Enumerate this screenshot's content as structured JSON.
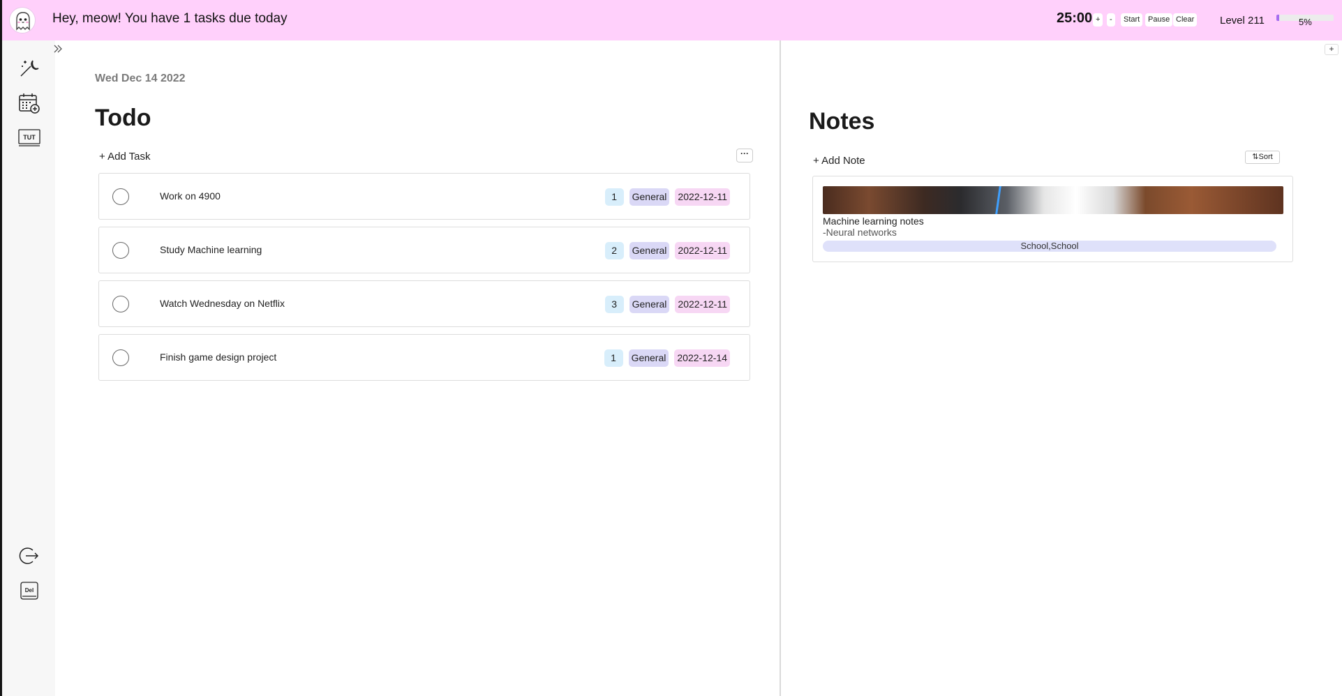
{
  "header": {
    "greeting": "Hey, meow! You have 1 tasks due today",
    "timer": "25:00",
    "timer_plus": "+",
    "timer_minus": "-",
    "start_label": "Start",
    "pause_label": "Pause",
    "clear_label": "Clear",
    "level_label": "Level 211",
    "xp_percent_label": "5%",
    "xp_progress": 0.05
  },
  "sidebar": {
    "items": [
      {
        "icon": "theme-toggle-icon"
      },
      {
        "icon": "calendar-add-icon"
      },
      {
        "icon": "tutorial-icon",
        "text": "TUT"
      },
      {
        "icon": "logout-icon"
      },
      {
        "icon": "delete-account-icon",
        "text": "Del"
      }
    ]
  },
  "todo": {
    "date": "Wed Dec 14 2022",
    "title": "Todo",
    "add_label": "+ Add Task",
    "more_label": "···",
    "tasks": [
      {
        "name": "Work on 4900",
        "priority": "1",
        "category": "General",
        "due": "2022-12-11"
      },
      {
        "name": "Study Machine learning",
        "priority": "2",
        "category": "General",
        "due": "2022-12-11"
      },
      {
        "name": "Watch Wednesday on Netflix",
        "priority": "3",
        "category": "General",
        "due": "2022-12-11"
      },
      {
        "name": "Finish game design project",
        "priority": "1",
        "category": "General",
        "due": "2022-12-14"
      }
    ]
  },
  "notes": {
    "title": "Notes",
    "add_label": "+ Add Note",
    "sort_label": "⇅Sort",
    "corner_label": "+",
    "items": [
      {
        "title": "Machine learning notes",
        "body": "-Neural networks",
        "tags": "School,School"
      }
    ]
  },
  "colors": {
    "header_bg": "#ffd0fb",
    "priority_tag": "#d8eefb",
    "category_tag": "#dad8f6",
    "due_tag": "#f7d7f4",
    "xp_fill": "#a66cf0"
  }
}
